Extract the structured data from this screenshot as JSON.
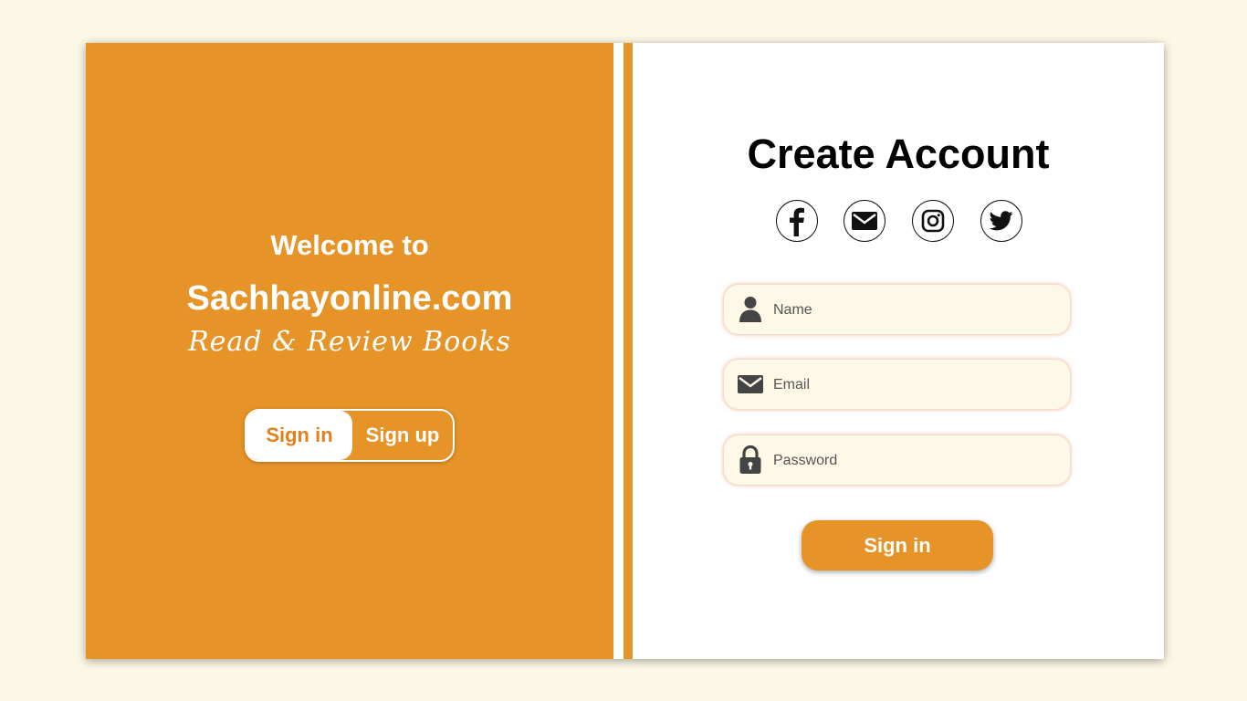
{
  "left_panel": {
    "welcome": "Welcome to",
    "site_name": "Sachhayonline.com",
    "tagline": "Read & Review Books",
    "toggle": {
      "sign_in": "Sign in",
      "sign_up": "Sign up",
      "active": "sign_in"
    }
  },
  "form": {
    "title": "Create Account",
    "social_icons": [
      "facebook-icon",
      "mail-icon",
      "instagram-icon",
      "twitter-icon"
    ],
    "name_placeholder": "Name",
    "email_placeholder": "Email",
    "password_placeholder": "Password",
    "submit_label": "Sign in"
  },
  "colors": {
    "accent": "#e69328",
    "page_background": "#fdf8e6",
    "field_background": "#fef8e6"
  }
}
